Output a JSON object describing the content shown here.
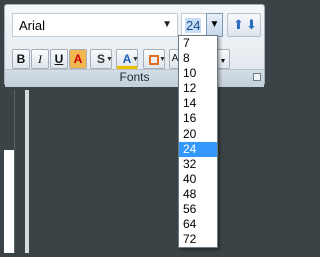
{
  "font": {
    "name": "Arial"
  },
  "size": {
    "value": "24"
  },
  "group": {
    "label": "Fonts"
  },
  "sizes": [
    "7",
    "8",
    "10",
    "12",
    "14",
    "16",
    "20",
    "24",
    "32",
    "40",
    "48",
    "56",
    "64",
    "72"
  ],
  "selected_size": "24",
  "colors": {
    "accent": "#3399ff",
    "frame": "#3b4346"
  }
}
